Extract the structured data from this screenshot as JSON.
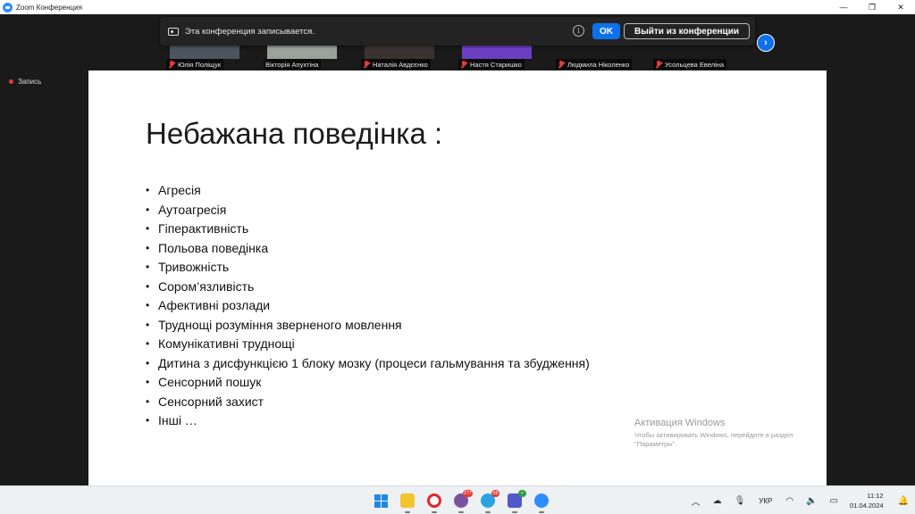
{
  "window": {
    "title": "Zoom Конференция",
    "controls": [
      "minimize-icon",
      "maximize-icon",
      "close-icon"
    ]
  },
  "banner": {
    "message": "Эта конференция записывается.",
    "info_icon": "i",
    "ok_label": "OK",
    "leave_label": "Выйти из конференции"
  },
  "participants": [
    {
      "name": "Юлія Поліщук",
      "thumb": "#4c5560"
    },
    {
      "name": "Вікторія Апухтіна",
      "thumb": "#9aa39a"
    },
    {
      "name": "Наталія Авдєєнко",
      "thumb": "#3b3330"
    },
    {
      "name": "Настя Старишко",
      "thumb": "#6b3fc1"
    },
    {
      "name": "Людмила Ніколенко",
      "thumb": "#1a1a1a"
    },
    {
      "name": "Усольцева Евеліна",
      "thumb": "#1a1a1a"
    }
  ],
  "recording_label": "Запись",
  "next_icon": "›",
  "slide": {
    "title": "Небажана поведінка :",
    "bullet": "•",
    "items": [
      "Агресія",
      "Аутоагресія",
      "Гіперактивність",
      "Польова поведінка",
      "Тривожність",
      "Сором’язливість",
      "Афективні розлади",
      "Труднощі розуміння зверненого мовлення",
      "Комунікативні труднощі",
      "Дитина з дисфункцією 1 блоку мозку (процеси гальмування та збудження)",
      "Сенсорний пошук",
      "Сенсорний захист",
      "Інші …"
    ]
  },
  "watermark": {
    "title": "Активация Windows",
    "subtitle": "Чтобы активировать Windows, перейдите в раздел \"Параметры\"."
  },
  "taskbar": {
    "apps": [
      {
        "name": "windows-start",
        "color": "#1e88e5",
        "badge": ""
      },
      {
        "name": "file-explorer",
        "color": "#f4c430",
        "badge": ""
      },
      {
        "name": "opera",
        "color": "#e0282c",
        "badge": ""
      },
      {
        "name": "viber",
        "color": "#7b519d",
        "badge": "277"
      },
      {
        "name": "telegram",
        "color": "#2aa3e0",
        "badge": "58"
      },
      {
        "name": "teams",
        "color": "#5059c9",
        "badge": "✓"
      },
      {
        "name": "zoom",
        "color": "#2d8cff",
        "badge": ""
      }
    ],
    "language": "УКР",
    "time": "11:12",
    "date": "01.04.2024"
  }
}
